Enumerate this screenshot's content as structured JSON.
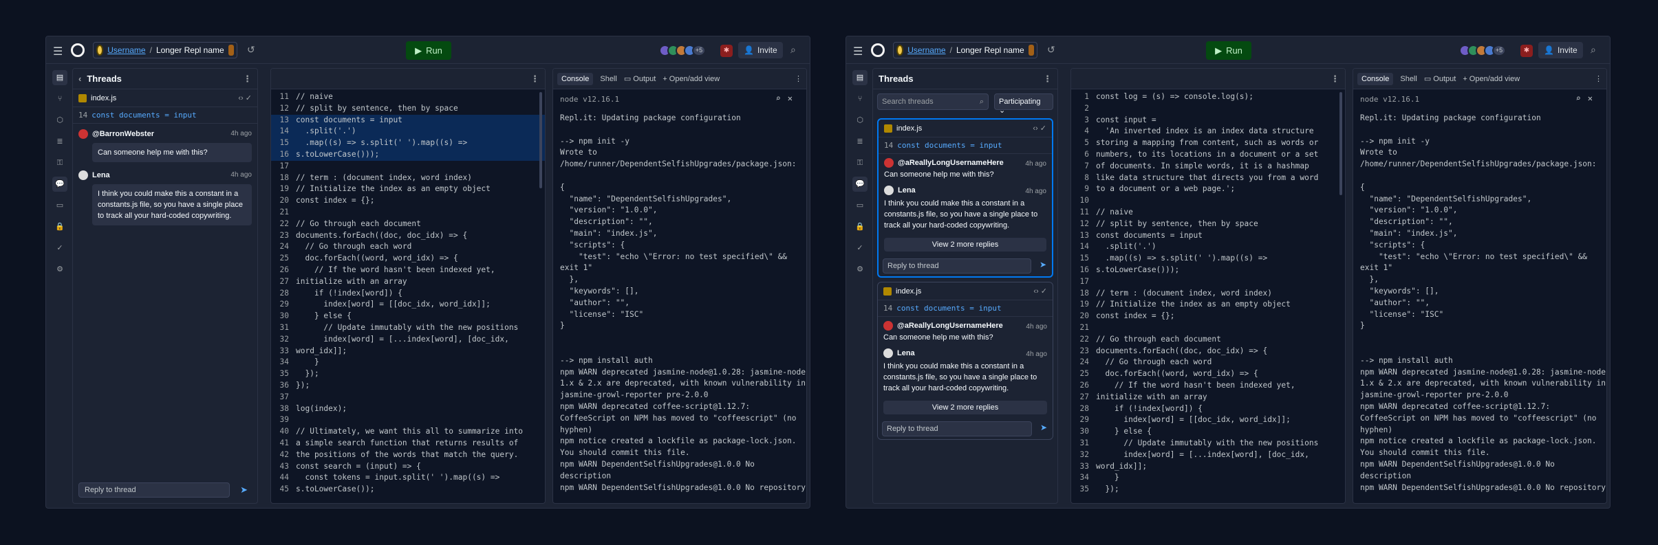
{
  "colors": {
    "background": "#0c1220",
    "surface": "#1c2333",
    "accent": "#0079f2",
    "run": "#044a10"
  },
  "header": {
    "username": "Username",
    "separator": "/",
    "repl_name": "Longer Repl name",
    "run_label": "Run",
    "collab_count": "+5",
    "invite_label": "Invite"
  },
  "thread_panel": {
    "title": "Threads",
    "file": "index.js",
    "code_line_no": "14",
    "code_line": "const documents = input",
    "msg1_author": "@BarronWebster",
    "msg1_time": "4h ago",
    "msg1_text": "Can someone help me with this?",
    "msg2_author": "Lena",
    "msg2_time": "4h ago",
    "msg2_text": "I think you could make this a constant in a constants.js file, so you have a single place to track all your hard-coded copywriting.",
    "reply_placeholder": "Reply to thread"
  },
  "threads_list": {
    "title": "Threads",
    "search_placeholder": "Search threads",
    "filter": "Participating",
    "file": "index.js",
    "code_line_no": "14",
    "code_line": "const documents = input",
    "author1": "@aReallyLongUsernameHere",
    "time": "4h ago",
    "text1": "Can someone help me with this?",
    "author2": "Lena",
    "text2": "I think you could make this a constant in a constants.js file, so you have a single place to track all your hard-coded copywriting.",
    "view_more": "View 2 more replies",
    "reply_placeholder": "Reply to thread"
  },
  "console": {
    "tabs": [
      "Console",
      "Shell",
      "Output",
      "Open/add view"
    ],
    "version": "node v12.16.1",
    "lines": [
      "Repl.it: Updating package configuration",
      "",
      "--> npm init -y",
      "Wrote to",
      "/home/runner/DependentSelfishUpgrades/package.json:",
      "",
      "{",
      "  \"name\": \"DependentSelfishUpgrades\",",
      "  \"version\": \"1.0.0\",",
      "  \"description\": \"\",",
      "  \"main\": \"index.js\",",
      "  \"scripts\": {",
      "    \"test\": \"echo \\\"Error: no test specified\\\" &&",
      "exit 1\"",
      "  },",
      "  \"keywords\": [],",
      "  \"author\": \"\",",
      "  \"license\": \"ISC\"",
      "}",
      "",
      "",
      "--> npm install auth",
      "npm WARN deprecated jasmine-node@1.0.28: jasmine-node",
      "1.x & 2.x are deprecated, with known vulnerability in",
      "jasmine-growl-reporter pre-2.0.0",
      "npm WARN deprecated coffee-script@1.12.7:",
      "CoffeeScript on NPM has moved to \"coffeescript\" (no",
      "hyphen)",
      "npm notice created a lockfile as package-lock.json.",
      "You should commit this file.",
      "npm WARN DependentSelfishUpgrades@1.0.0 No",
      "description",
      "npm WARN DependentSelfishUpgrades@1.0.0 No repository"
    ]
  },
  "editor1": {
    "lines": [
      {
        "n": "11",
        "t": "// naive",
        "c": "cm"
      },
      {
        "n": "12",
        "t": "// split by sentence, then by space",
        "c": "cm"
      },
      {
        "n": "13",
        "t": "const documents = input",
        "c": "pl",
        "hl": true
      },
      {
        "n": "14",
        "t": "  .split('.')",
        "c": "pl",
        "hl": true
      },
      {
        "n": "15",
        "t": "  .map((s) => s.split(' ').map((s) =>",
        "c": "pl",
        "hl": true
      },
      {
        "n": "16",
        "t": "s.toLowerCase()));",
        "c": "pl",
        "hl": true
      },
      {
        "n": "17",
        "t": "",
        "c": "pl"
      },
      {
        "n": "18",
        "t": "// term : (document index, word index)",
        "c": "cm"
      },
      {
        "n": "19",
        "t": "// Initialize the index as an empty object",
        "c": "cm"
      },
      {
        "n": "20",
        "t": "const index = {};",
        "c": "pl"
      },
      {
        "n": "21",
        "t": "",
        "c": "pl"
      },
      {
        "n": "22",
        "t": "// Go through each document",
        "c": "cm"
      },
      {
        "n": "23",
        "t": "documents.forEach((doc, doc_idx) => {",
        "c": "pl"
      },
      {
        "n": "24",
        "t": "  // Go through each word",
        "c": "cm"
      },
      {
        "n": "25",
        "t": "  doc.forEach((word, word_idx) => {",
        "c": "pl"
      },
      {
        "n": "26",
        "t": "    // If the word hasn't been indexed yet,",
        "c": "cm"
      },
      {
        "n": "27",
        "t": "initialize with an array",
        "c": "cm"
      },
      {
        "n": "28",
        "t": "    if (!index[word]) {",
        "c": "pl"
      },
      {
        "n": "29",
        "t": "      index[word] = [[doc_idx, word_idx]];",
        "c": "pl"
      },
      {
        "n": "30",
        "t": "    } else {",
        "c": "pl"
      },
      {
        "n": "31",
        "t": "      // Update immutably with the new positions",
        "c": "cm"
      },
      {
        "n": "32",
        "t": "      index[word] = [...index[word], [doc_idx,",
        "c": "pl"
      },
      {
        "n": "33",
        "t": "word_idx]];",
        "c": "pl"
      },
      {
        "n": "34",
        "t": "    }",
        "c": "pl"
      },
      {
        "n": "35",
        "t": "  });",
        "c": "pl"
      },
      {
        "n": "36",
        "t": "});",
        "c": "pl"
      },
      {
        "n": "37",
        "t": "",
        "c": "pl"
      },
      {
        "n": "38",
        "t": "log(index);",
        "c": "pl"
      },
      {
        "n": "39",
        "t": "",
        "c": "pl"
      },
      {
        "n": "40",
        "t": "// Ultimately, we want this all to summarize into",
        "c": "cm"
      },
      {
        "n": "41",
        "t": "a simple search function that returns results of",
        "c": "cm"
      },
      {
        "n": "42",
        "t": "the positions of the words that match the query.",
        "c": "cm"
      },
      {
        "n": "43",
        "t": "const search = (input) => {",
        "c": "pl"
      },
      {
        "n": "44",
        "t": "  const tokens = input.split(' ').map((s) =>",
        "c": "pl"
      },
      {
        "n": "45",
        "t": "s.toLowerCase());",
        "c": "pl"
      }
    ]
  },
  "editor2": {
    "lines": [
      {
        "n": "1",
        "t": "const log = (s) => console.log(s);",
        "c": "pl"
      },
      {
        "n": "2",
        "t": "",
        "c": "pl"
      },
      {
        "n": "3",
        "t": "const input =",
        "c": "pl"
      },
      {
        "n": "4",
        "t": "  'An inverted index is an index data structure",
        "c": "st"
      },
      {
        "n": "5",
        "t": "storing a mapping from content, such as words or",
        "c": "st"
      },
      {
        "n": "6",
        "t": "numbers, to its locations in a document or a set",
        "c": "st"
      },
      {
        "n": "7",
        "t": "of documents. In simple words, it is a hashmap",
        "c": "st"
      },
      {
        "n": "8",
        "t": "like data structure that directs you from a word",
        "c": "st"
      },
      {
        "n": "9",
        "t": "to a document or a web page.';",
        "c": "st"
      },
      {
        "n": "10",
        "t": "",
        "c": "pl"
      },
      {
        "n": "11",
        "t": "// naive",
        "c": "cm"
      },
      {
        "n": "12",
        "t": "// split by sentence, then by space",
        "c": "cm"
      },
      {
        "n": "13",
        "t": "const documents = input",
        "c": "pl"
      },
      {
        "n": "14",
        "t": "  .split('.')",
        "c": "pl"
      },
      {
        "n": "15",
        "t": "  .map((s) => s.split(' ').map((s) =>",
        "c": "pl"
      },
      {
        "n": "16",
        "t": "s.toLowerCase()));",
        "c": "pl"
      },
      {
        "n": "17",
        "t": "",
        "c": "pl"
      },
      {
        "n": "18",
        "t": "// term : (document index, word index)",
        "c": "cm"
      },
      {
        "n": "19",
        "t": "// Initialize the index as an empty object",
        "c": "cm"
      },
      {
        "n": "20",
        "t": "const index = {};",
        "c": "pl"
      },
      {
        "n": "21",
        "t": "",
        "c": "pl"
      },
      {
        "n": "22",
        "t": "// Go through each document",
        "c": "cm"
      },
      {
        "n": "23",
        "t": "documents.forEach((doc, doc_idx) => {",
        "c": "pl"
      },
      {
        "n": "24",
        "t": "  // Go through each word",
        "c": "cm"
      },
      {
        "n": "25",
        "t": "  doc.forEach((word, word_idx) => {",
        "c": "pl"
      },
      {
        "n": "26",
        "t": "    // If the word hasn't been indexed yet,",
        "c": "cm"
      },
      {
        "n": "27",
        "t": "initialize with an array",
        "c": "cm"
      },
      {
        "n": "28",
        "t": "    if (!index[word]) {",
        "c": "pl"
      },
      {
        "n": "29",
        "t": "      index[word] = [[doc_idx, word_idx]];",
        "c": "pl"
      },
      {
        "n": "30",
        "t": "    } else {",
        "c": "pl"
      },
      {
        "n": "31",
        "t": "      // Update immutably with the new positions",
        "c": "cm"
      },
      {
        "n": "32",
        "t": "      index[word] = [...index[word], [doc_idx,",
        "c": "pl"
      },
      {
        "n": "33",
        "t": "word_idx]];",
        "c": "pl"
      },
      {
        "n": "34",
        "t": "    }",
        "c": "pl"
      },
      {
        "n": "35",
        "t": "  });",
        "c": "pl"
      }
    ]
  }
}
